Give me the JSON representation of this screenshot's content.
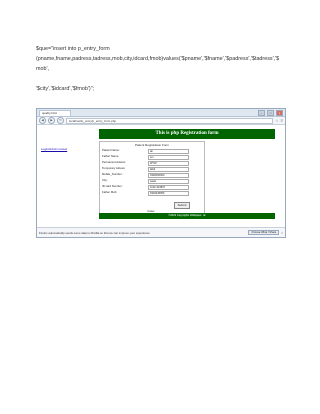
{
  "code": {
    "line1": "$que=\"insert into p_entry_form (pname,fname,padress,tadress,mob,city,idcard,fmob)values('$pname','$fname','$padress','$tadress','$ mob',",
    "line2": "'$city','$idcard','$fmob')\";"
  },
  "browser": {
    "tab_title": "quality.html",
    "url": "localhost/p_entry/p_entry_form.php",
    "window_controls": {
      "minimize": "–",
      "maximize": "□",
      "close": "x"
    },
    "nav_icons": [
      "back-icon",
      "forward-icon",
      "refresh-icon"
    ]
  },
  "page": {
    "home_link": "Login/Admin review",
    "banner": "This is php Registration form",
    "form_legend": "Patient Registration Form",
    "fields": [
      {
        "label": "Patient Name:",
        "value": "ali"
      },
      {
        "label": "Father Name:",
        "value": "sm"
      },
      {
        "label": "Permanent Adress:",
        "value": "WYW"
      },
      {
        "label": "Temporary Adress:",
        "value": "kkkk"
      },
      {
        "label": "Mobile_Number:",
        "value": "0300000000"
      },
      {
        "label": "City:",
        "value": "wwla"
      },
      {
        "label": "ID card Number:",
        "value": "1122-324567"
      },
      {
        "label": "Father Mob:",
        "value": "0303245656"
      }
    ],
    "submit_label": "Submit",
    "foot_label": "footer",
    "footer_text": "©2023 Copyrights Wallpaper, ok"
  },
  "statusbar": {
    "message": "Firefox automatically sends some data to Mozilla so that we can improve your experience.",
    "button": "Choose What I Share",
    "close": "×"
  }
}
